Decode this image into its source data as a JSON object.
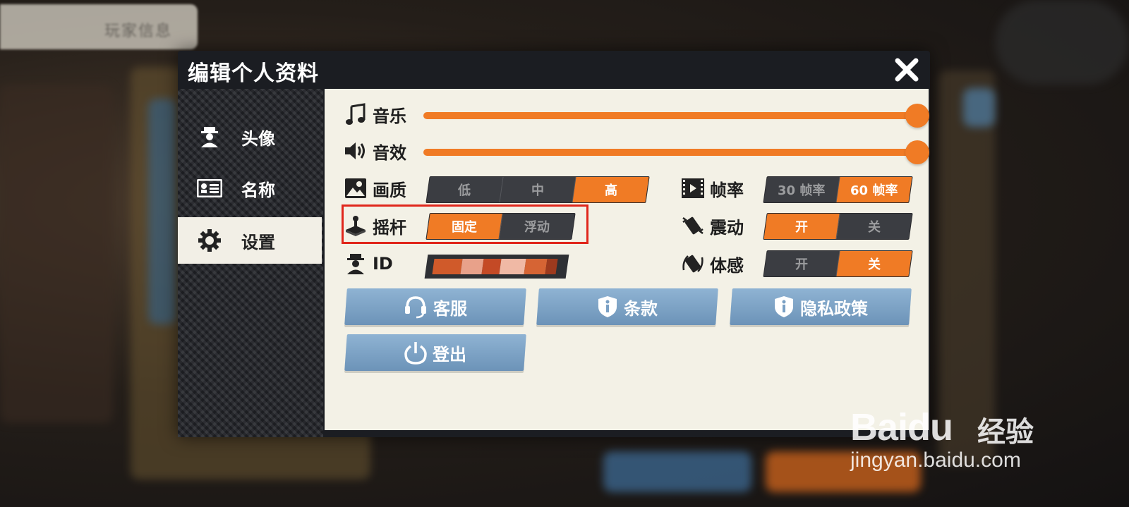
{
  "background": {
    "top_tab_label": "玩家信息"
  },
  "dialog": {
    "title": "编辑个人资料",
    "close_icon": "close-icon"
  },
  "sidebar": {
    "items": [
      {
        "label": "头像",
        "icon": "avatar-icon",
        "active": false
      },
      {
        "label": "名称",
        "icon": "name-card-icon",
        "active": false
      },
      {
        "label": "设置",
        "icon": "gear-icon",
        "active": true
      }
    ]
  },
  "settings": {
    "music": {
      "label": "音乐",
      "icon": "music-note-icon",
      "value_percent": 100
    },
    "sfx": {
      "label": "音效",
      "icon": "speaker-icon",
      "value_percent": 100
    },
    "quality": {
      "label": "画质",
      "icon": "image-icon",
      "options": [
        "低",
        "中",
        "高"
      ],
      "selected": "高"
    },
    "framerate": {
      "label": "帧率",
      "icon": "film-icon",
      "options": [
        "30 帧率",
        "60 帧率"
      ],
      "selected": "60 帧率"
    },
    "joystick": {
      "label": "摇杆",
      "icon": "joystick-icon",
      "options": [
        "固定",
        "浮动"
      ],
      "selected": "固定"
    },
    "vibration": {
      "label": "震动",
      "icon": "vibrate-icon",
      "options": [
        "开",
        "关"
      ],
      "selected": "开"
    },
    "motion": {
      "label": "体感",
      "icon": "motion-sensor-icon",
      "options": [
        "开",
        "关"
      ],
      "selected": "关"
    },
    "id": {
      "label": "ID",
      "icon": "user-id-icon"
    }
  },
  "actions": {
    "support": {
      "label": "客服",
      "icon": "headset-icon"
    },
    "terms": {
      "label": "条款",
      "icon": "shield-info-icon"
    },
    "privacy": {
      "label": "隐私政策",
      "icon": "shield-info-icon"
    },
    "logout": {
      "label": "登出",
      "icon": "power-icon"
    }
  },
  "watermark": {
    "logo_text": "Baidu",
    "cn_text": "经验",
    "url": "jingyan.baidu.com"
  },
  "colors": {
    "accent": "#f07b25",
    "highlight_box": "#e0261b",
    "button_blue": "#7aa0c4"
  }
}
